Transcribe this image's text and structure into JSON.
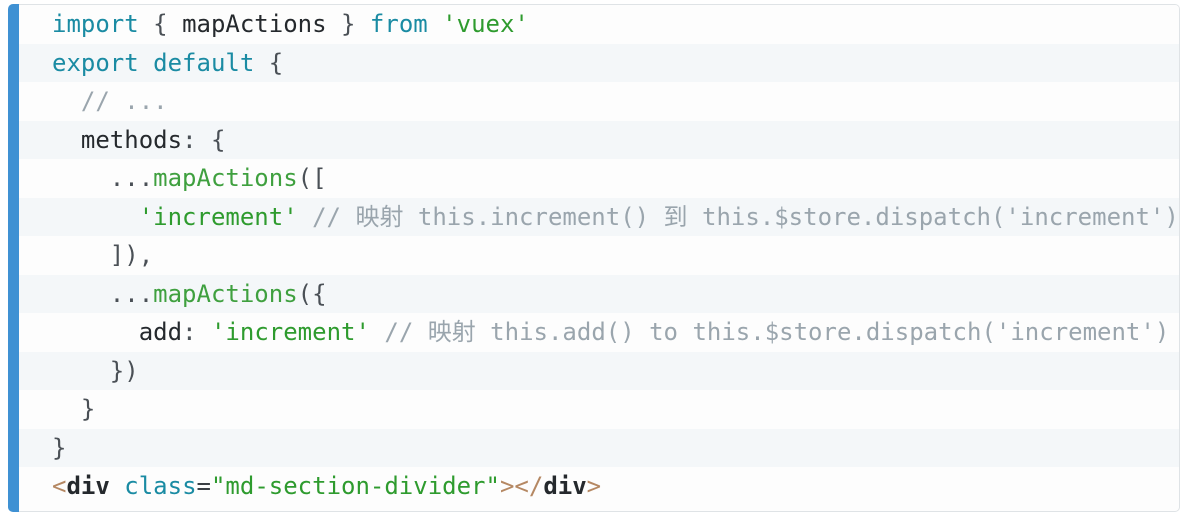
{
  "code_block": {
    "language": "js",
    "accent_color": "#3f91d3",
    "background_odd": "#fdfdfd",
    "background_even": "#f4f7f9",
    "border_color": "#dfe3e6",
    "colors": {
      "keyword": "#1a8ba3",
      "string": "#2e9b2e",
      "comment": "#9aa5ad",
      "function": "#3fa03f",
      "plain": "#3a3f44",
      "tag_bracket": "#b58863",
      "tag_name": "#25292d",
      "attribute": "#1a8ba3"
    },
    "lines": [
      {
        "n": 1,
        "text": "import { mapActions } from 'vuex'",
        "tokens": [
          {
            "t": "keyword",
            "v": "import"
          },
          {
            "t": "plain",
            "v": " "
          },
          {
            "t": "punct",
            "v": "{"
          },
          {
            "t": "plain",
            "v": " "
          },
          {
            "t": "prop",
            "v": "mapActions"
          },
          {
            "t": "plain",
            "v": " "
          },
          {
            "t": "punct",
            "v": "}"
          },
          {
            "t": "plain",
            "v": " "
          },
          {
            "t": "keyword",
            "v": "from"
          },
          {
            "t": "plain",
            "v": " "
          },
          {
            "t": "string",
            "v": "'vuex'"
          }
        ]
      },
      {
        "n": 2,
        "text": "export default {",
        "tokens": [
          {
            "t": "keyword",
            "v": "export"
          },
          {
            "t": "plain",
            "v": " "
          },
          {
            "t": "keyword",
            "v": "default"
          },
          {
            "t": "plain",
            "v": " "
          },
          {
            "t": "punct",
            "v": "{"
          }
        ]
      },
      {
        "n": 3,
        "text": "  // ...",
        "tokens": [
          {
            "t": "plain",
            "v": "  "
          },
          {
            "t": "comment",
            "v": "// ..."
          }
        ]
      },
      {
        "n": 4,
        "text": "  methods: {",
        "tokens": [
          {
            "t": "plain",
            "v": "  "
          },
          {
            "t": "prop",
            "v": "methods"
          },
          {
            "t": "punct",
            "v": ":"
          },
          {
            "t": "plain",
            "v": " "
          },
          {
            "t": "punct",
            "v": "{"
          }
        ]
      },
      {
        "n": 5,
        "text": "    ...mapActions([",
        "tokens": [
          {
            "t": "plain",
            "v": "    "
          },
          {
            "t": "punct",
            "v": "..."
          },
          {
            "t": "func",
            "v": "mapActions"
          },
          {
            "t": "punct",
            "v": "(["
          }
        ]
      },
      {
        "n": 6,
        "text": "      'increment' // 映射 this.increment() 到 this.$store.dispatch('increment')",
        "tokens": [
          {
            "t": "plain",
            "v": "      "
          },
          {
            "t": "string",
            "v": "'increment'"
          },
          {
            "t": "plain",
            "v": " "
          },
          {
            "t": "comment",
            "v": "// 映射 this.increment() 到 this.$store.dispatch('increment')"
          }
        ]
      },
      {
        "n": 7,
        "text": "    ]),",
        "tokens": [
          {
            "t": "plain",
            "v": "    "
          },
          {
            "t": "punct",
            "v": "]),"
          }
        ]
      },
      {
        "n": 8,
        "text": "    ...mapActions({",
        "tokens": [
          {
            "t": "plain",
            "v": "    "
          },
          {
            "t": "punct",
            "v": "..."
          },
          {
            "t": "func",
            "v": "mapActions"
          },
          {
            "t": "punct",
            "v": "({"
          }
        ]
      },
      {
        "n": 9,
        "text": "      add: 'increment' // 映射 this.add() to this.$store.dispatch('increment')",
        "tokens": [
          {
            "t": "plain",
            "v": "      "
          },
          {
            "t": "prop",
            "v": "add"
          },
          {
            "t": "punct",
            "v": ":"
          },
          {
            "t": "plain",
            "v": " "
          },
          {
            "t": "string",
            "v": "'increment'"
          },
          {
            "t": "plain",
            "v": " "
          },
          {
            "t": "comment",
            "v": "// 映射 this.add() to this.$store.dispatch('increment')"
          }
        ]
      },
      {
        "n": 10,
        "text": "    })",
        "tokens": [
          {
            "t": "plain",
            "v": "    "
          },
          {
            "t": "punct",
            "v": "})"
          }
        ]
      },
      {
        "n": 11,
        "text": "  }",
        "tokens": [
          {
            "t": "plain",
            "v": "  "
          },
          {
            "t": "punct",
            "v": "}"
          }
        ]
      },
      {
        "n": 12,
        "text": "}",
        "tokens": [
          {
            "t": "punct",
            "v": "}"
          }
        ]
      },
      {
        "n": 13,
        "text": "<div class=\"md-section-divider\"></div>",
        "tokens": [
          {
            "t": "tagbr",
            "v": "<"
          },
          {
            "t": "tagname",
            "v": "div"
          },
          {
            "t": "plain",
            "v": " "
          },
          {
            "t": "attr",
            "v": "class"
          },
          {
            "t": "eq",
            "v": "="
          },
          {
            "t": "string",
            "v": "\"md-section-divider\""
          },
          {
            "t": "tagbr",
            "v": ">"
          },
          {
            "t": "tagbr",
            "v": "</"
          },
          {
            "t": "tagname",
            "v": "div"
          },
          {
            "t": "tagbr",
            "v": ">"
          }
        ]
      }
    ]
  }
}
